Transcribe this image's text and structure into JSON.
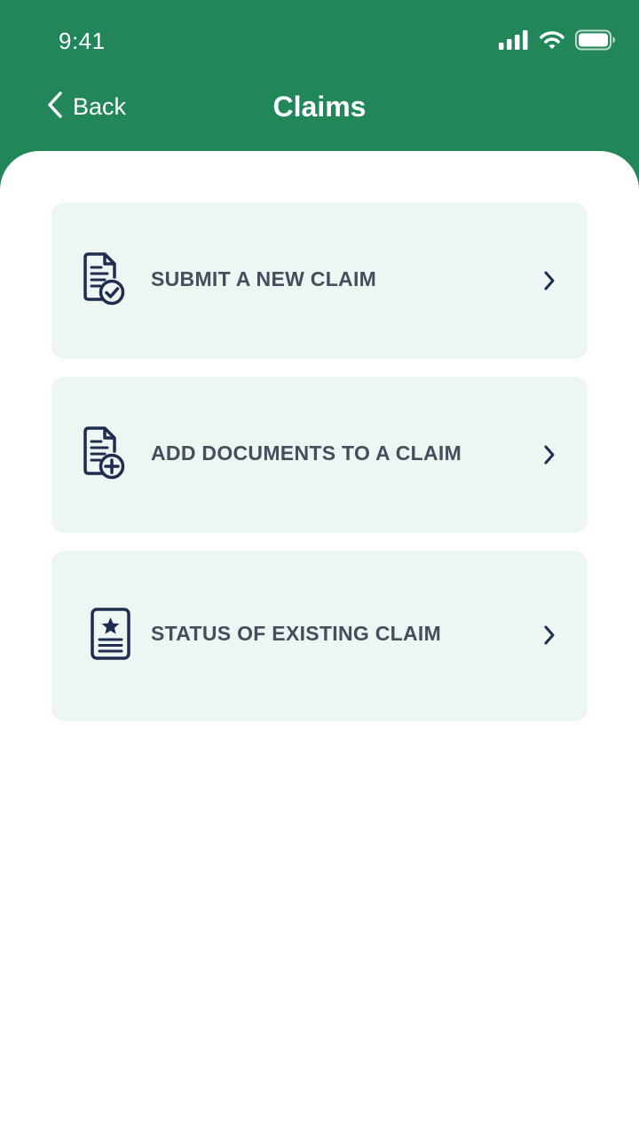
{
  "status_bar": {
    "time": "9:41",
    "icons": [
      "signal-icon",
      "wifi-icon",
      "battery-icon"
    ]
  },
  "nav": {
    "back_label": "Back",
    "title": "Claims",
    "back_icon": "chevron-left-icon"
  },
  "menu": {
    "items": [
      {
        "label": "SUBMIT A NEW CLAIM",
        "icon": "document-check-icon",
        "trailing_icon": "chevron-right-icon"
      },
      {
        "label": "ADD DOCUMENTS TO A CLAIM",
        "icon": "document-add-icon",
        "trailing_icon": "chevron-right-icon"
      },
      {
        "label": "STATUS OF EXISTING CLAIM",
        "icon": "document-star-icon",
        "trailing_icon": "chevron-right-icon"
      }
    ]
  },
  "colors": {
    "header_background": "#21865a",
    "card_background": "#edf6f3",
    "card_text": "#474d5c",
    "icon_color": "#1f2d4e",
    "page_background": "#ffffff"
  }
}
